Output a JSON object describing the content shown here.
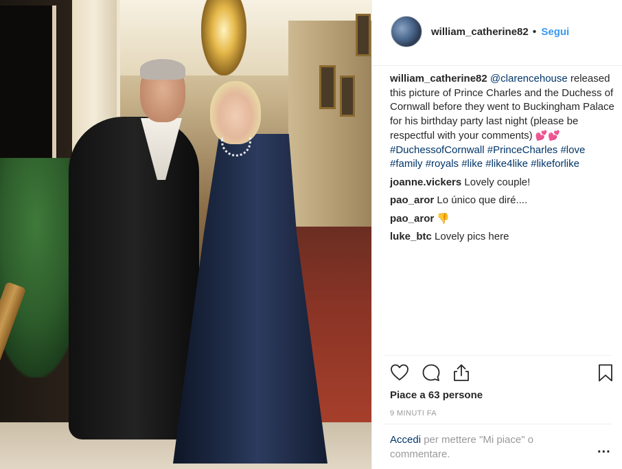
{
  "post": {
    "username": "william_catherine82",
    "separator": "•",
    "follow_label": "Segui"
  },
  "caption": {
    "username": "william_catherine82",
    "mention": "@clarencehouse",
    "text": "released this picture of Prince Charles and the Duchess of Cornwall before they went to Buckingham Palace for his birthday party last night (please be respectful with your comments)",
    "emoji": "💕💕",
    "hashtags": [
      "#DuchessofCornwall",
      "#PrinceCharles",
      "#love",
      "#family",
      "#royals",
      "#like",
      "#like4like",
      "#likeforlike"
    ]
  },
  "comments": [
    {
      "user": "joanne.vickers",
      "text": "Lovely couple!"
    },
    {
      "user": "pao_aror",
      "text": "Lo único que diré...."
    },
    {
      "user": "pao_aror",
      "text": "👎"
    },
    {
      "user": "luke_btc",
      "text": "Lovely pics here"
    }
  ],
  "actions": {
    "like_icon": "heart-outline-icon",
    "comment_icon": "comment-bubble-icon",
    "share_icon": "share-upload-icon",
    "save_icon": "bookmark-icon"
  },
  "likes_text": "Piace a 63 persone",
  "time_ago": "9 MINUTI FA",
  "login_prompt": {
    "link": "Accedi",
    "text": " per mettere \"Mi piace\" o commentare."
  },
  "more_options": "...",
  "colors": {
    "link": "#003569",
    "follow": "#3897f0",
    "muted": "#999999",
    "text": "#262626"
  }
}
